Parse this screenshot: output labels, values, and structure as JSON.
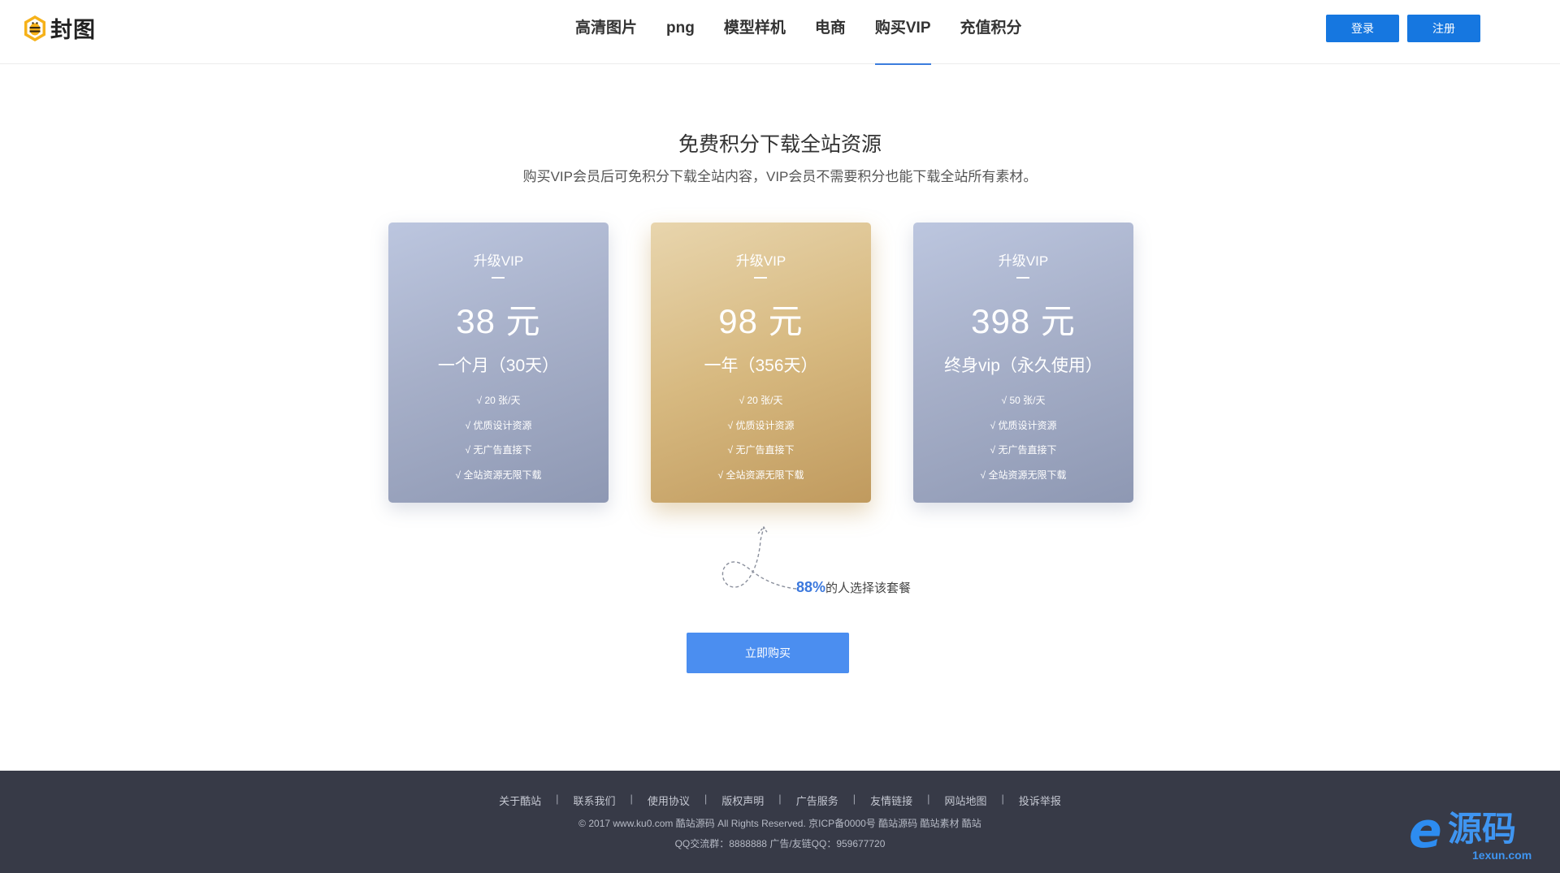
{
  "header": {
    "logo_text": "封图",
    "nav": [
      "高清图片",
      "png",
      "模型样机",
      "电商",
      "购买VIP",
      "充值积分"
    ],
    "active_nav_index": 4,
    "login_label": "登录",
    "register_label": "注册"
  },
  "hero": {
    "title": "免费积分下载全站资源",
    "subtitle": "购买VIP会员后可免积分下载全站内容，VIP会员不需要积分也能下载全站所有素材。"
  },
  "plans": [
    {
      "tier": "升级VIP",
      "price": "38 元",
      "period": "一个月（30天）",
      "features": [
        "√ 20 张/天",
        "√ 优质设计资源",
        "√ 无广告直接下",
        "√ 全站资源无限下载"
      ],
      "highlighted": false
    },
    {
      "tier": "升级VIP",
      "price": "98 元",
      "period": "一年（356天）",
      "features": [
        "√ 20 张/天",
        "√ 优质设计资源",
        "√ 无广告直接下",
        "√ 全站资源无限下载"
      ],
      "highlighted": true
    },
    {
      "tier": "升级VIP",
      "price": "398 元",
      "period": "终身vip（永久使用）",
      "features": [
        "√ 50 张/天",
        "√ 优质设计资源",
        "√ 无广告直接下",
        "√ 全站资源无限下载"
      ],
      "highlighted": false
    }
  ],
  "popular": {
    "percent": "88%",
    "text": "的人选择该套餐"
  },
  "buy_label": "立即购买",
  "footer": {
    "links": [
      "关于酷站",
      "联系我们",
      "使用协议",
      "版权声明",
      "广告服务",
      "友情链接",
      "网站地图",
      "投诉举报"
    ],
    "separator": "|",
    "copyright": "© 2017 www.ku0.com 酷站源码 All Rights Reserved. 京ICP备0000号 酷站源码 酷站素材 酷站",
    "qq": "QQ交流群：8888888 广告/友链QQ：959677720"
  },
  "watermark": {
    "letter": "e",
    "text": "源码",
    "domain": "1exun.com"
  },
  "colors": {
    "primary": "#1677e0",
    "buy": "#4b8ef0",
    "accent_text": "#3b78dd",
    "footer_bg": "#373a47",
    "card_gold": "#d7b980",
    "card_blue": "#a7b0c9"
  }
}
